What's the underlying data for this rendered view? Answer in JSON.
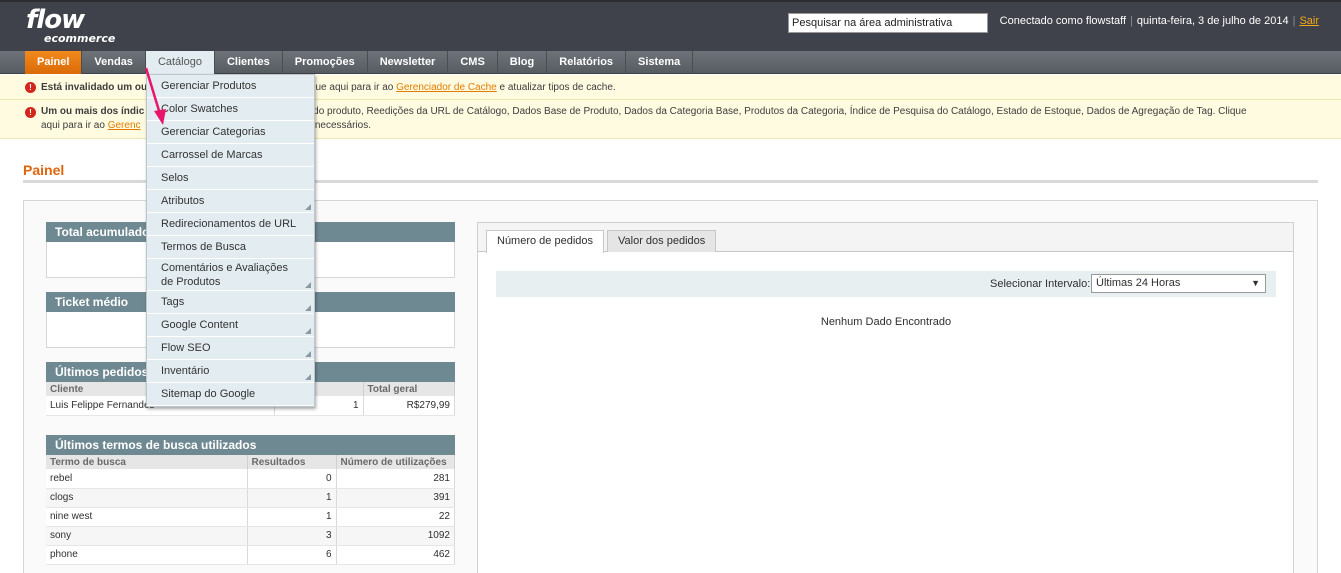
{
  "header": {
    "logo_main": "flow",
    "logo_sub": "ecommerce",
    "search_value": "Pesquisar na área administrativa",
    "logged_in": "Conectado como flowstaff",
    "date": "quinta-feira, 3 de julho de 2014",
    "logout": "Sair"
  },
  "nav": {
    "items": [
      "Painel",
      "Vendas",
      "Catálogo",
      "Clientes",
      "Promoções",
      "Newsletter",
      "CMS",
      "Blog",
      "Relatórios",
      "Sistema"
    ]
  },
  "notices": [
    {
      "bold": "Está invalidado um ou",
      "pre": "que aqui para ir ao",
      "link": "Gerenciador de Cache",
      "post": "e atualizar tipos de cache."
    },
    {
      "bold": "Um ou mais dos índic",
      "line1": "s do produto, Reedições da URL de Catálogo, Dados Base de Produto, Dados da Categoria Base, Produtos da Categoria, Índice de Pesquisa do Catálogo, Estado de Estoque, Dados de Agregação de Tag. Clique",
      "line2_pre": "aqui para ir ao",
      "link": "Gerenc",
      "line2_post": "ces necessários."
    }
  ],
  "page_title": "Painel",
  "sections": {
    "total": "Total acumulado",
    "ticket": "Ticket médio",
    "orders": "Últimos pedidos",
    "search_terms": "Últimos termos de busca utilizados"
  },
  "orders_table": {
    "headers": [
      "Cliente",
      "",
      "Total geral"
    ],
    "rows": [
      [
        "Luis Felippe Fernandes",
        "1",
        "R$279,99"
      ]
    ]
  },
  "search_table": {
    "headers": [
      "Termo de busca",
      "Resultados",
      "Número de utilizações"
    ],
    "rows": [
      [
        "rebel",
        "0",
        "281"
      ],
      [
        "clogs",
        "1",
        "391"
      ],
      [
        "nine west",
        "1",
        "22"
      ],
      [
        "sony",
        "3",
        "1092"
      ],
      [
        "phone",
        "6",
        "462"
      ]
    ]
  },
  "chart": {
    "tabs": [
      "Número de pedidos",
      "Valor dos pedidos"
    ],
    "range_label": "Selecionar Intervalo:",
    "range_value": "Últimas 24 Horas",
    "no_data": "Nenhum Dado Encontrado"
  },
  "catalog_menu": [
    {
      "label": "Gerenciar Produtos",
      "sub": false
    },
    {
      "label": "Color Swatches",
      "sub": false
    },
    {
      "label": "Gerenciar Categorias",
      "sub": false
    },
    {
      "label": "Carrossel de Marcas",
      "sub": false
    },
    {
      "label": "Selos",
      "sub": false
    },
    {
      "label": "Atributos",
      "sub": true
    },
    {
      "label": "Redirecionamentos de URL",
      "sub": false
    },
    {
      "label": "Termos de Busca",
      "sub": false
    },
    {
      "label": "Comentários e Avaliações de Produtos",
      "sub": true
    },
    {
      "label": "Tags",
      "sub": true
    },
    {
      "label": "Google Content",
      "sub": true
    },
    {
      "label": "Flow SEO",
      "sub": true
    },
    {
      "label": "Inventário",
      "sub": true
    },
    {
      "label": "Sitemap do Google",
      "sub": false
    }
  ],
  "colors": {
    "accent": "#e0640c",
    "header_bg": "#3f424a",
    "section_head": "#6f8992",
    "annotation_arrow": "#e8156b"
  },
  "icons": {
    "notice": "error-icon",
    "submenu": "submenu-arrow-icon",
    "select": "chevron-down-icon"
  }
}
